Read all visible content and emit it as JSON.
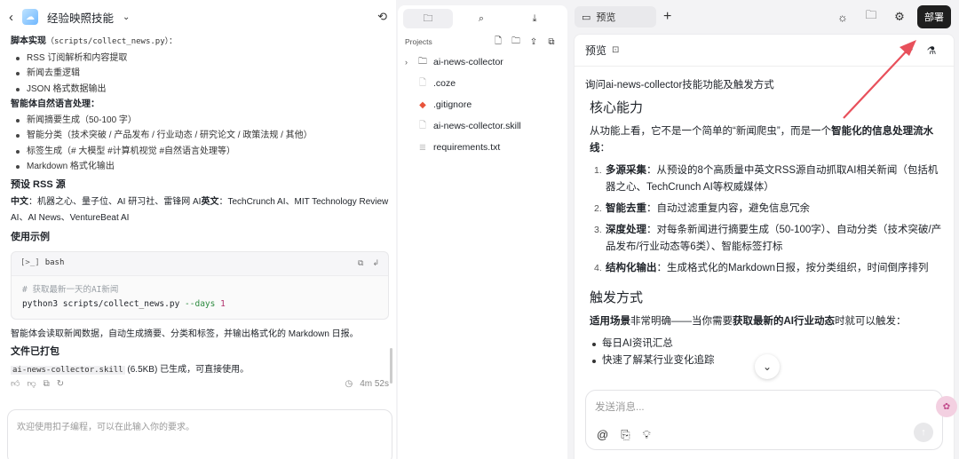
{
  "left": {
    "title": "经验映照技能",
    "content": {
      "script_title": "脚本实现",
      "script_path": "（scripts/collect_news.py）：",
      "script_items": [
        "RSS 订阅解析和内容提取",
        "新闻去重逻辑",
        "JSON 格式数据输出"
      ],
      "nlp_title": "智能体自然语言处理：",
      "nlp_items": [
        "新闻摘要生成（50-100 字）",
        "智能分类（技术突破 / 产品发布 / 行业动态 / 研究论文 / 政策法规 / 其他）",
        "标签生成（# 大模型 #计算机视觉 #自然语言处理等）",
        "Markdown 格式化输出"
      ],
      "rss_heading": "预设 RSS 源",
      "rss_cn_label": "中文",
      "rss_cn": "：机器之心、量子位、AI 研习社、雷锋网 AI",
      "rss_en_label": "英文",
      "rss_en_1": "：TechCrunch AI、MIT Technology Review",
      "rss_en_2": "AI、AI News、VentureBeat AI",
      "usage_heading": "使用示例",
      "code_lang": "bash",
      "code_comment": "# 获取最新一天的AI新闻",
      "code_cmd": "python3 scripts/collect_news.py ",
      "code_flag": "--days",
      "code_num": "1",
      "after_code": "智能体会读取新闻数据，自动生成摘要、分类和标签，并输出格式化的 Markdown 日报。",
      "packed_heading": "文件已打包",
      "packed_file": "ai-news-collector.skill",
      "packed_desc": " (6.5KB) 已生成，可直接使用。"
    },
    "elapsed": "4m 52s",
    "input_placeholder": "欢迎使用扣子编程，可以在此输入你的要求。"
  },
  "middle": {
    "projects_label": "Projects",
    "files": [
      {
        "name": "ai-news-collector",
        "type": "folder"
      },
      {
        "name": ".coze",
        "type": "file"
      },
      {
        "name": ".gitignore",
        "type": "git"
      },
      {
        "name": "ai-news-collector.skill",
        "type": "file"
      },
      {
        "name": "requirements.txt",
        "type": "text"
      }
    ]
  },
  "right": {
    "tab_label": "预览",
    "deploy_label": "部署",
    "preview_title": "预览",
    "question": "询问ai-news-collector技能功能及触发方式",
    "core_heading": "核心能力",
    "core_intro_a": "从功能上看，它不是一个简单的“新闻爬虫”，而是一个",
    "core_intro_b": "智能化的信息处理流水线",
    "core_intro_c": "：",
    "capabilities": [
      {
        "n": "1.",
        "label": "多源采集",
        "text": "：从预设的8个高质量中英文RSS源自动抓取AI相关新闻（包括机器之心、TechCrunch AI等权威媒体）"
      },
      {
        "n": "2.",
        "label": "智能去重",
        "text": "：自动过滤重复内容，避免信息冗余"
      },
      {
        "n": "3.",
        "label": "深度处理",
        "text": "：对每条新闻进行摘要生成（50-100字）、自动分类（技术突破/产品发布/行业动态等6类）、智能标签打标"
      },
      {
        "n": "4.",
        "label": "结构化输出",
        "text": "：生成格式化的Markdown日报，按分类组织，时间倒序排列"
      }
    ],
    "trigger_heading": "触发方式",
    "trigger_a": "适用场景",
    "trigger_b": "非常明确——当你需要",
    "trigger_c": "获取最新的AI行业动态",
    "trigger_d": "时就可以触发：",
    "trigger_items": [
      "每日AI资讯汇总",
      "快速了解某行业变化追踪"
    ],
    "input_placeholder": "发送消息..."
  }
}
